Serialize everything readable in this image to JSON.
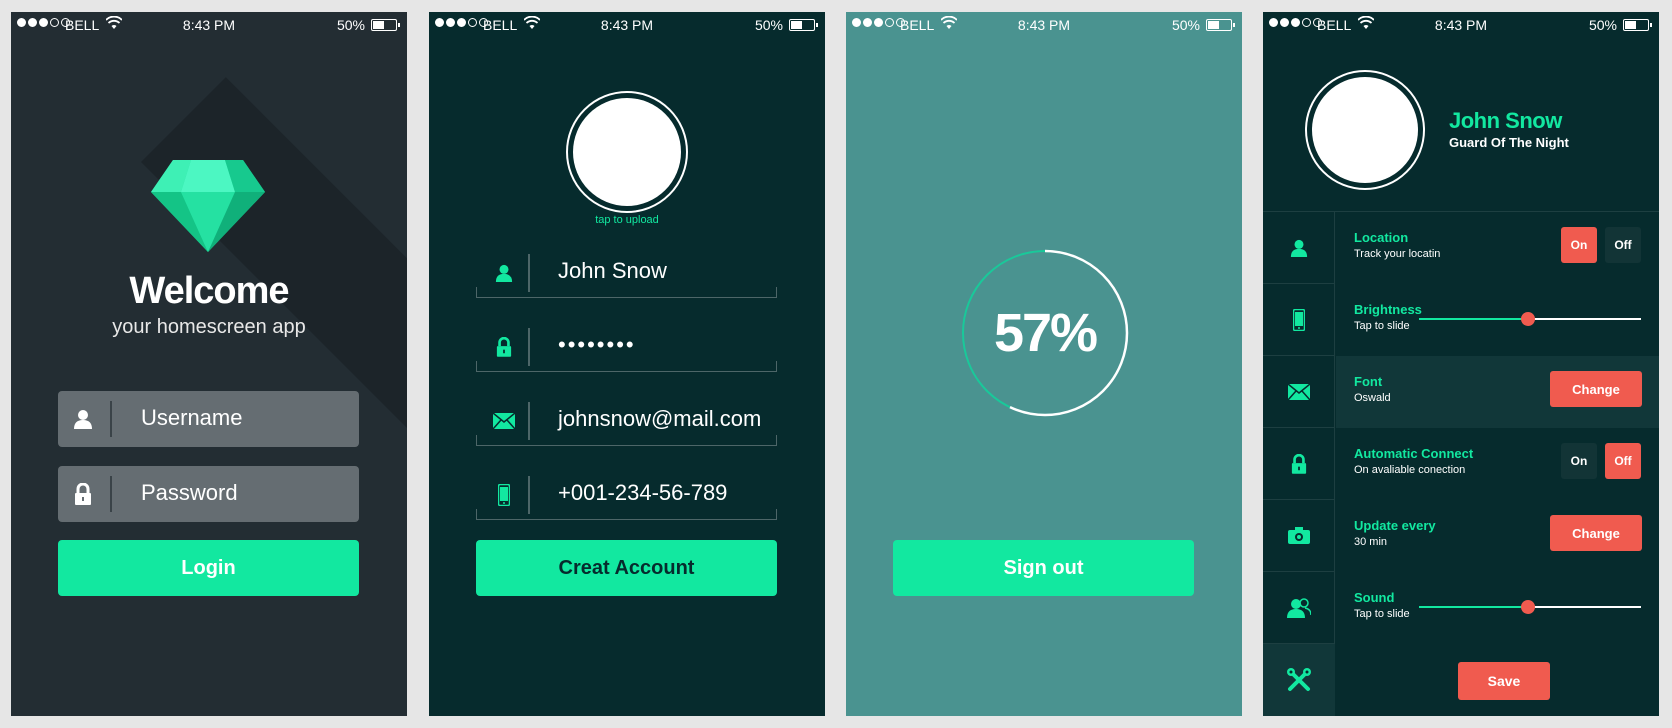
{
  "status_bar": {
    "carrier": "BELL",
    "time": "8:43 PM",
    "battery": "50%",
    "battery_level": 0.5
  },
  "login_screen": {
    "title": "Welcome",
    "subtitle": "your homescreen app",
    "username_placeholder": "Username",
    "password_placeholder": "Password",
    "login_label": "Login"
  },
  "register_screen": {
    "upload_hint": "tap to upload",
    "name_value": "John Snow",
    "password_value": "••••••••",
    "email_value": "johnsnow@mail.com",
    "phone_value": "+001-234-56-789",
    "create_label": "Creat Account"
  },
  "progress_screen": {
    "progress_value": 0.57,
    "progress_text": "57%",
    "signout_label": "Sign out"
  },
  "settings_screen": {
    "profile_name": "John Snow",
    "profile_title": "Guard Of The Night",
    "sidebar_icons": [
      "user-icon",
      "phone-icon",
      "mail-icon",
      "lock-icon",
      "camera-icon",
      "contacts-icon",
      "tools-icon"
    ],
    "location": {
      "label": "Location",
      "sub": "Track your locatin",
      "on": "On",
      "off": "Off",
      "selected": "On"
    },
    "brightness": {
      "label": "Brightness",
      "sub": "Tap to slide",
      "value": 0.49
    },
    "font": {
      "label": "Font",
      "sub": "Oswald",
      "button": "Change"
    },
    "auto_connect": {
      "label": "Automatic Connect",
      "sub": "On avaliable conection",
      "on": "On",
      "off": "Off",
      "selected": "Off"
    },
    "update": {
      "label": "Update every",
      "sub": "30 min",
      "button": "Change"
    },
    "sound": {
      "label": "Sound",
      "sub": "Tap to slide",
      "value": 0.49
    },
    "save_label": "Save"
  },
  "colors": {
    "accent_green": "#12e8a0",
    "accent_red": "#f05b4f",
    "dark_teal": "#062b2d",
    "slate": "#232d33",
    "mid_teal": "#4a9390"
  }
}
